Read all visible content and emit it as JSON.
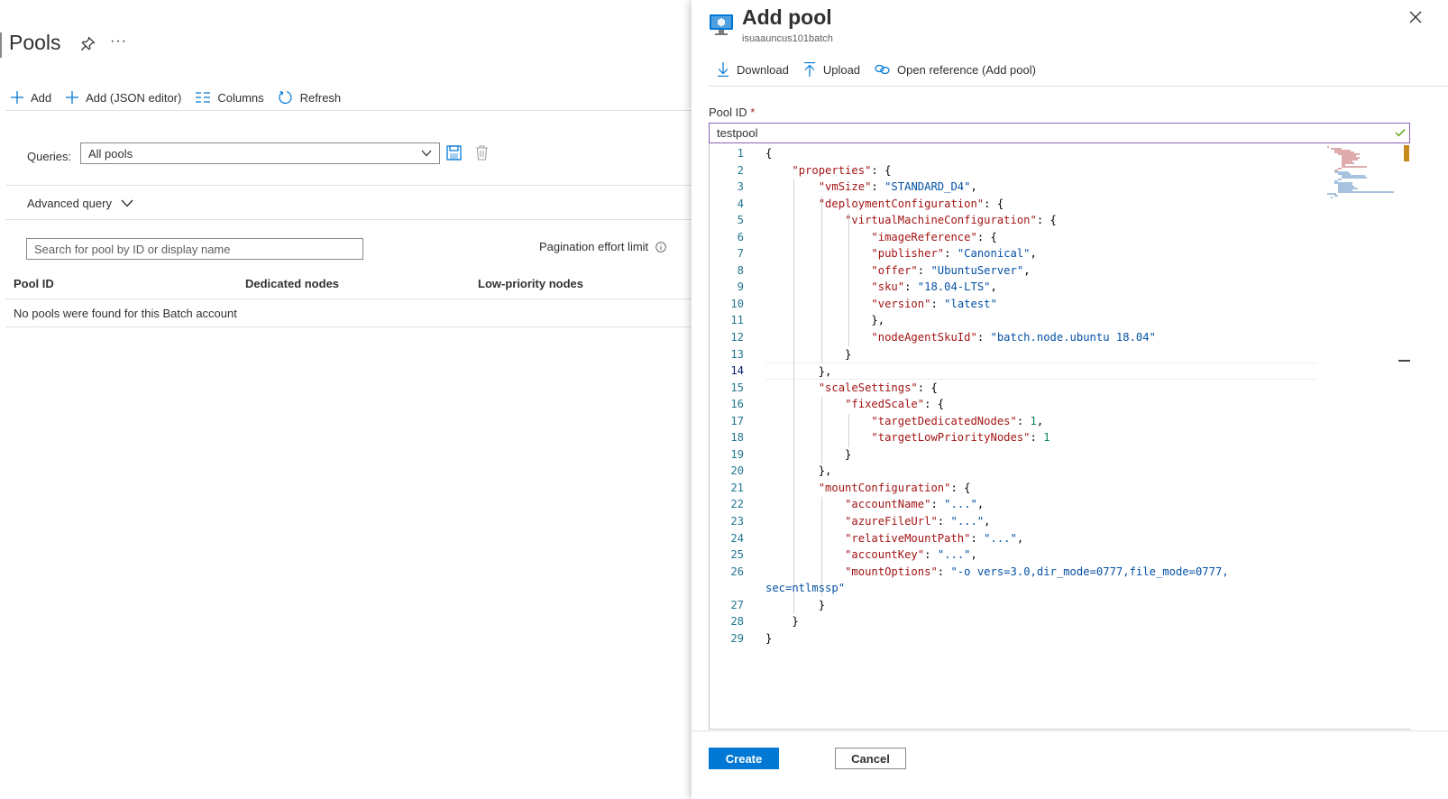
{
  "pools_blade": {
    "title": "Pools",
    "more": "···",
    "commands": [
      {
        "label": "Add",
        "icon": "plus-icon"
      },
      {
        "label": "Add (JSON editor)",
        "icon": "plus-icon"
      },
      {
        "label": "Columns",
        "icon": "columns-icon"
      },
      {
        "label": "Refresh",
        "icon": "refresh-icon"
      }
    ],
    "queries_label": "Queries:",
    "queries_value": "All pools",
    "advanced_query": "Advanced query",
    "search_placeholder": "Search for pool by ID or display name",
    "pagination_label": "Pagination effort limit",
    "columns": [
      "Pool ID",
      "Dedicated nodes",
      "Low-priority nodes"
    ],
    "empty_message": "No pools were found for this Batch account"
  },
  "panel": {
    "title": "Add pool",
    "subtitle": "isuaauncus101batch",
    "toolbar": [
      {
        "label": "Download",
        "icon": "download-icon"
      },
      {
        "label": "Upload",
        "icon": "upload-icon"
      },
      {
        "label": "Open reference (Add pool)",
        "icon": "link-icon"
      }
    ],
    "pool_id_label": "Pool ID",
    "required_mark": "*",
    "pool_id_value": "testpool",
    "create_label": "Create",
    "cancel_label": "Cancel"
  },
  "editor": {
    "line_numbers": [
      "1",
      "2",
      "3",
      "4",
      "5",
      "6",
      "7",
      "8",
      "9",
      "10",
      "11",
      "12",
      "13",
      "14",
      "15",
      "16",
      "17",
      "18",
      "19",
      "20",
      "21",
      "22",
      "23",
      "24",
      "25",
      "26",
      "",
      "27",
      "28",
      "29"
    ],
    "active_line": 14,
    "lines": [
      [
        {
          "t": "p",
          "v": "{"
        }
      ],
      [
        {
          "t": "p",
          "v": "    "
        },
        {
          "t": "k",
          "v": "\"properties\""
        },
        {
          "t": "p",
          "v": ": {"
        }
      ],
      [
        {
          "t": "p",
          "v": "        "
        },
        {
          "t": "k",
          "v": "\"vmSize\""
        },
        {
          "t": "p",
          "v": ": "
        },
        {
          "t": "s",
          "v": "\"STANDARD_D4\""
        },
        {
          "t": "p",
          "v": ","
        }
      ],
      [
        {
          "t": "p",
          "v": "        "
        },
        {
          "t": "k",
          "v": "\"deploymentConfiguration\""
        },
        {
          "t": "p",
          "v": ": {"
        }
      ],
      [
        {
          "t": "p",
          "v": "            "
        },
        {
          "t": "k",
          "v": "\"virtualMachineConfiguration\""
        },
        {
          "t": "p",
          "v": ": {"
        }
      ],
      [
        {
          "t": "p",
          "v": "                "
        },
        {
          "t": "k",
          "v": "\"imageReference\""
        },
        {
          "t": "p",
          "v": ": {"
        }
      ],
      [
        {
          "t": "p",
          "v": "                "
        },
        {
          "t": "k",
          "v": "\"publisher\""
        },
        {
          "t": "p",
          "v": ": "
        },
        {
          "t": "s",
          "v": "\"Canonical\""
        },
        {
          "t": "p",
          "v": ","
        }
      ],
      [
        {
          "t": "p",
          "v": "                "
        },
        {
          "t": "k",
          "v": "\"offer\""
        },
        {
          "t": "p",
          "v": ": "
        },
        {
          "t": "s",
          "v": "\"UbuntuServer\""
        },
        {
          "t": "p",
          "v": ","
        }
      ],
      [
        {
          "t": "p",
          "v": "                "
        },
        {
          "t": "k",
          "v": "\"sku\""
        },
        {
          "t": "p",
          "v": ": "
        },
        {
          "t": "s",
          "v": "\"18.04-LTS\""
        },
        {
          "t": "p",
          "v": ","
        }
      ],
      [
        {
          "t": "p",
          "v": "                "
        },
        {
          "t": "k",
          "v": "\"version\""
        },
        {
          "t": "p",
          "v": ": "
        },
        {
          "t": "s",
          "v": "\"latest\""
        }
      ],
      [
        {
          "t": "p",
          "v": "                },"
        }
      ],
      [
        {
          "t": "p",
          "v": "                "
        },
        {
          "t": "k",
          "v": "\"nodeAgentSkuId\""
        },
        {
          "t": "p",
          "v": ": "
        },
        {
          "t": "s",
          "v": "\"batch.node.ubuntu 18.04\""
        }
      ],
      [
        {
          "t": "p",
          "v": "            }"
        }
      ],
      [
        {
          "t": "p",
          "v": "        },"
        }
      ],
      [
        {
          "t": "p",
          "v": "        "
        },
        {
          "t": "k",
          "v": "\"scaleSettings\""
        },
        {
          "t": "p",
          "v": ": {"
        }
      ],
      [
        {
          "t": "p",
          "v": "            "
        },
        {
          "t": "k",
          "v": "\"fixedScale\""
        },
        {
          "t": "p",
          "v": ": {"
        }
      ],
      [
        {
          "t": "p",
          "v": "                "
        },
        {
          "t": "k",
          "v": "\"targetDedicatedNodes\""
        },
        {
          "t": "p",
          "v": ": "
        },
        {
          "t": "n",
          "v": "1"
        },
        {
          "t": "p",
          "v": ","
        }
      ],
      [
        {
          "t": "p",
          "v": "                "
        },
        {
          "t": "k",
          "v": "\"targetLowPriorityNodes\""
        },
        {
          "t": "p",
          "v": ": "
        },
        {
          "t": "n",
          "v": "1"
        }
      ],
      [
        {
          "t": "p",
          "v": "            }"
        }
      ],
      [
        {
          "t": "p",
          "v": "        },"
        }
      ],
      [
        {
          "t": "p",
          "v": "        "
        },
        {
          "t": "k",
          "v": "\"mountConfiguration\""
        },
        {
          "t": "p",
          "v": ": {"
        }
      ],
      [
        {
          "t": "p",
          "v": "            "
        },
        {
          "t": "k",
          "v": "\"accountName\""
        },
        {
          "t": "p",
          "v": ": "
        },
        {
          "t": "s",
          "v": "\"...\""
        },
        {
          "t": "p",
          "v": ","
        }
      ],
      [
        {
          "t": "p",
          "v": "            "
        },
        {
          "t": "k",
          "v": "\"azureFileUrl\""
        },
        {
          "t": "p",
          "v": ": "
        },
        {
          "t": "s",
          "v": "\"...\""
        },
        {
          "t": "p",
          "v": ","
        }
      ],
      [
        {
          "t": "p",
          "v": "            "
        },
        {
          "t": "k",
          "v": "\"relativeMountPath\""
        },
        {
          "t": "p",
          "v": ": "
        },
        {
          "t": "s",
          "v": "\"...\""
        },
        {
          "t": "p",
          "v": ","
        }
      ],
      [
        {
          "t": "p",
          "v": "            "
        },
        {
          "t": "k",
          "v": "\"accountKey\""
        },
        {
          "t": "p",
          "v": ": "
        },
        {
          "t": "s",
          "v": "\"...\""
        },
        {
          "t": "p",
          "v": ","
        }
      ],
      [
        {
          "t": "p",
          "v": "            "
        },
        {
          "t": "k",
          "v": "\"mountOptions\""
        },
        {
          "t": "p",
          "v": ": "
        },
        {
          "t": "s",
          "v": "\"-o vers=3.0,dir_mode=0777,file_mode=0777,"
        }
      ],
      [
        {
          "t": "s",
          "v": "sec=ntlmssp\""
        }
      ],
      [
        {
          "t": "p",
          "v": "        }"
        }
      ],
      [
        {
          "t": "p",
          "v": "    }"
        }
      ],
      [
        {
          "t": "p",
          "v": "}"
        }
      ]
    ]
  }
}
